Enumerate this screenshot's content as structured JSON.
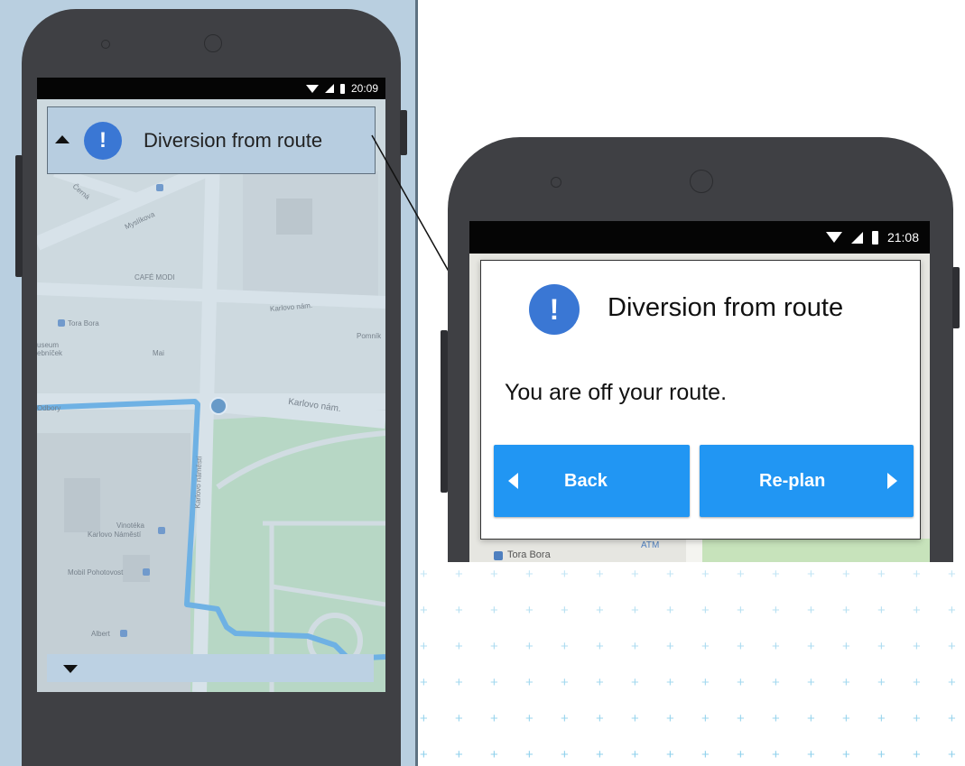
{
  "left_phone": {
    "status_time": "20:09",
    "banner": {
      "title": "Diversion from route",
      "expand_icon": "triangle-up-icon",
      "alert_icon": "exclamation-icon"
    },
    "map_labels": {
      "cerna": "Černá",
      "myslikova": "Myslíkova",
      "cafe": "CAFÉ MODI",
      "karlovo1": "Karlovo nám.",
      "karlovo2": "Karlovo nám.",
      "tora_bora": "Tora Bora",
      "museum": "useum",
      "museum2": "ebníček",
      "mai": "Mai",
      "pomnik": "Pomník",
      "odbory": "Odbory",
      "odbo": "Odbor",
      "karlovo_namesti_v": "Karlovo náměstí",
      "vinoteka": "Vinotéka",
      "vinoteka2": "Karlovo Náměstí",
      "mobil": "Mobil Pohotovost",
      "albert": "Albert"
    },
    "bottom_bar_icon": "triangle-down-icon"
  },
  "right_phone": {
    "status_time": "21:08",
    "dialog": {
      "title": "Diversion from route",
      "message": "You are off your route.",
      "back_label": "Back",
      "replan_label": "Re-plan"
    },
    "map_labels": {
      "tora_bora": "Tora Bora",
      "atm": "ATM"
    }
  },
  "colors": {
    "accent_blue": "#2196f3",
    "alert_blue": "#3a77d4",
    "route_blue": "#4aa3e6",
    "overlay": "#b9cfe0"
  }
}
